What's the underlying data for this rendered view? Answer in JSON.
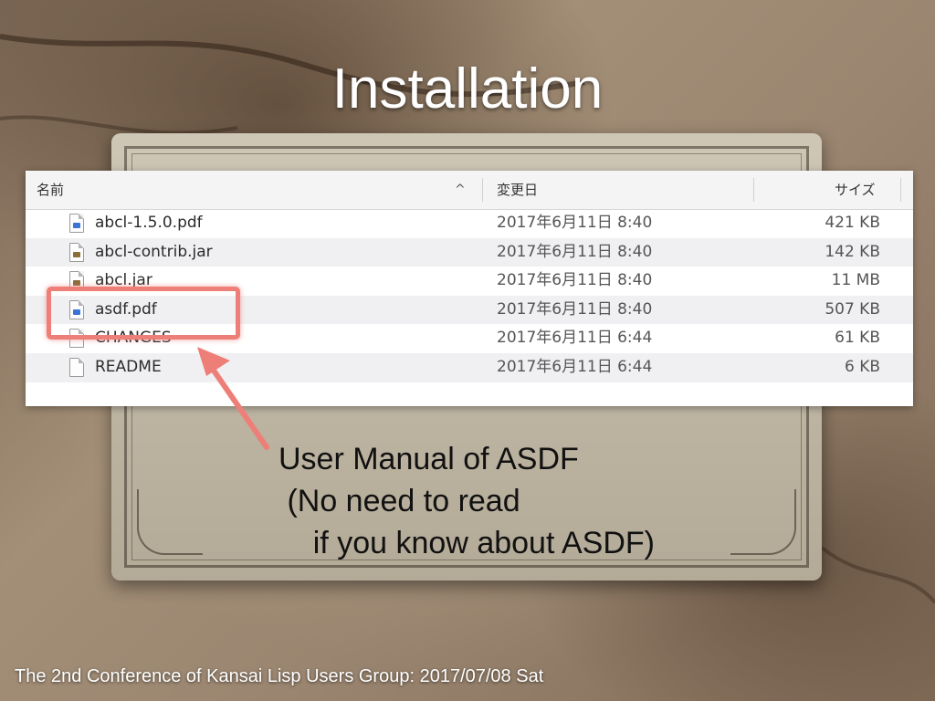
{
  "slide": {
    "title": "Installation",
    "footer": "The 2nd Conference of Kansai Lisp Users Group: 2017/07/08 Sat"
  },
  "finder": {
    "columns": {
      "name": "名前",
      "sort_indicator": "^",
      "date": "変更日",
      "size": "サイズ"
    },
    "rows": [
      {
        "name": "abcl-1.5.0.pdf",
        "date": "2017年6月11日 8:40",
        "size": "421 KB",
        "icon": "pdf-file-icon"
      },
      {
        "name": "abcl-contrib.jar",
        "date": "2017年6月11日 8:40",
        "size": "142 KB",
        "icon": "jar-file-icon"
      },
      {
        "name": "abcl.jar",
        "date": "2017年6月11日 8:40",
        "size": "11 MB",
        "icon": "jar-file-icon"
      },
      {
        "name": "asdf.pdf",
        "date": "2017年6月11日 8:40",
        "size": "507 KB",
        "icon": "pdf-file-icon"
      },
      {
        "name": "CHANGES",
        "date": "2017年6月11日 6:44",
        "size": "61 KB",
        "icon": "text-file-icon"
      },
      {
        "name": "README",
        "date": "2017年6月11日 6:44",
        "size": "6 KB",
        "icon": "text-file-icon"
      }
    ]
  },
  "annotation": {
    "line1": "User Manual of ASDF",
    "line2": " (No need to read",
    "line3": "    if you know about ASDF)"
  },
  "colors": {
    "highlight": "#ee7f78",
    "title_text": "#ffffff"
  }
}
